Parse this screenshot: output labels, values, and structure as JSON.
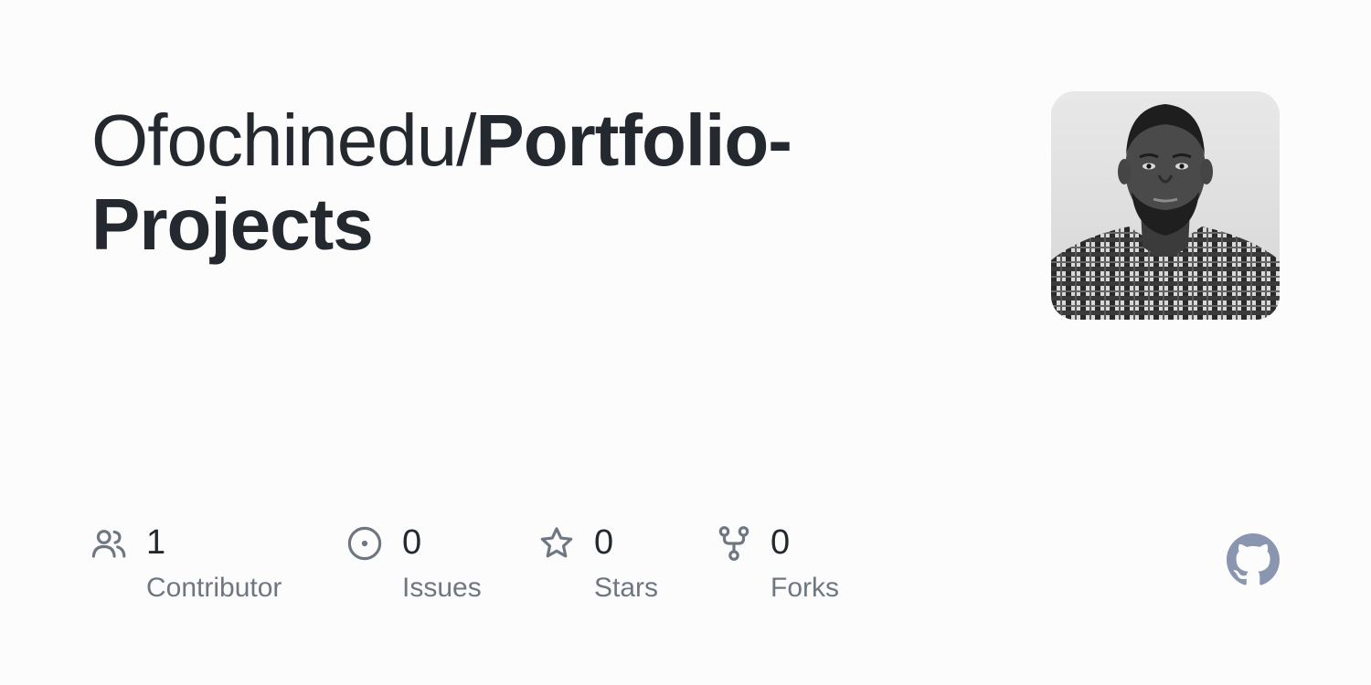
{
  "repo": {
    "owner": "Ofochinedu/",
    "name": "Portfolio-Projects"
  },
  "avatar": {
    "icon": "user-avatar-photo"
  },
  "stats": {
    "contributors": {
      "count": "1",
      "label": "Contributor",
      "icon": "people-icon"
    },
    "issues": {
      "count": "0",
      "label": "Issues",
      "icon": "issue-opened-icon"
    },
    "stars": {
      "count": "0",
      "label": "Stars",
      "icon": "star-icon"
    },
    "forks": {
      "count": "0",
      "label": "Forks",
      "icon": "repo-forked-icon"
    }
  },
  "colors": {
    "background": "#fdfcfd",
    "title": "#24292f",
    "muted": "#6e7781",
    "github_logo": "#8a96b0"
  }
}
